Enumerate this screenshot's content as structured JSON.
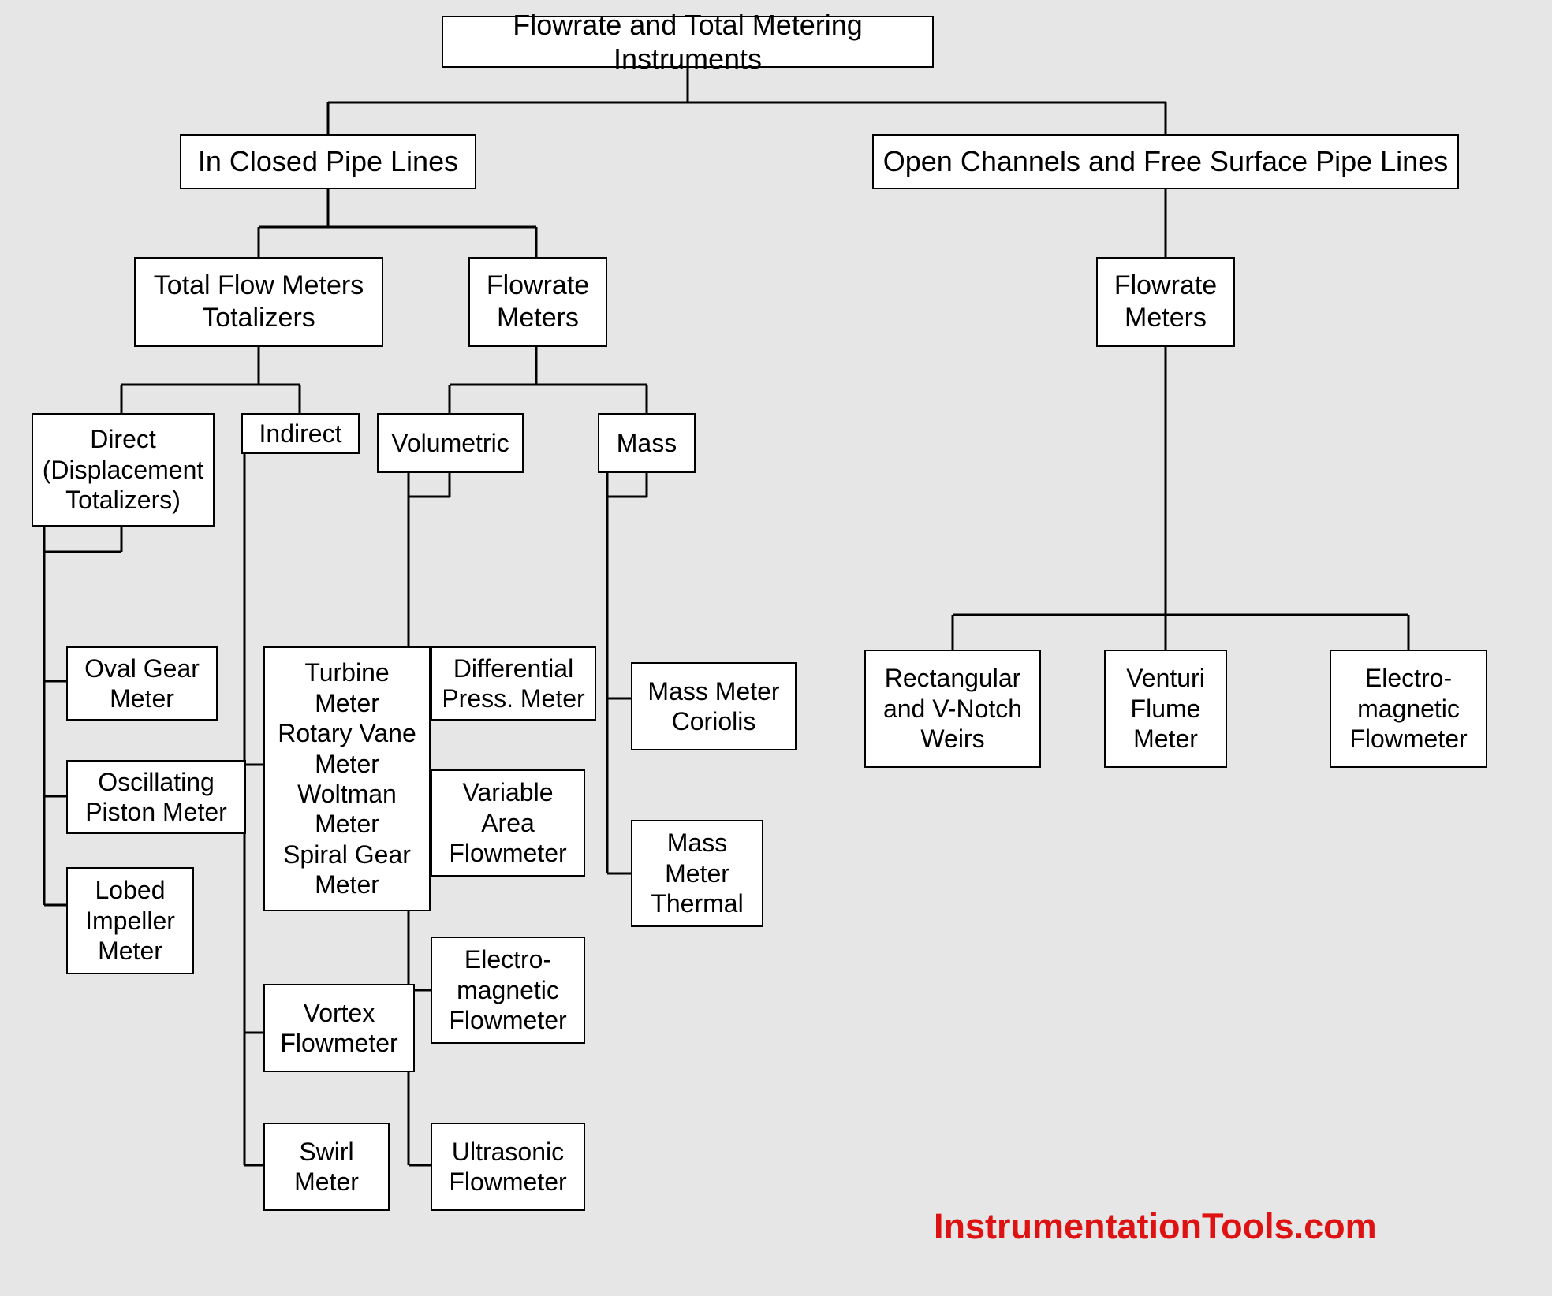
{
  "root": "Flowrate and Total Metering Instruments",
  "l2a": "In Closed Pipe Lines",
  "l2b": "Open Channels and Free Surface Pipe Lines",
  "l3a": "Total Flow Meters\nTotalizers",
  "l3b": "Flowrate\nMeters",
  "l3c": "Flowrate\nMeters",
  "l4a": "Direct\n(Displacement\nTotalizers)",
  "l4b": "Indirect",
  "l4c": "Volumetric",
  "l4d": "Mass",
  "d1": "Oval Gear\nMeter",
  "d2": "Oscillating\nPiston  Meter",
  "d3": "Lobed\nImpeller\nMeter",
  "i1": "Turbine\nMeter\nRotary Vane\nMeter\nWoltman\nMeter\nSpiral Gear\nMeter",
  "i2": "Vortex\nFlowmeter",
  "i3": "Swirl\nMeter",
  "v1": "Differential\nPress. Meter",
  "v2": "Variable\nArea\nFlowmeter",
  "v3": "Electro-\nmagnetic\nFlowmeter",
  "v4": "Ultrasonic\nFlowmeter",
  "m1": "Mass Meter\nCoriolis",
  "m2": "Mass\nMeter\nThermal",
  "o1": "Rectangular\nand V-Notch\nWeirs",
  "o2": "Venturi\nFlume\nMeter",
  "o3": "Electro-\nmagnetic\nFlowmeter",
  "watermark": "InstrumentationTools.com"
}
